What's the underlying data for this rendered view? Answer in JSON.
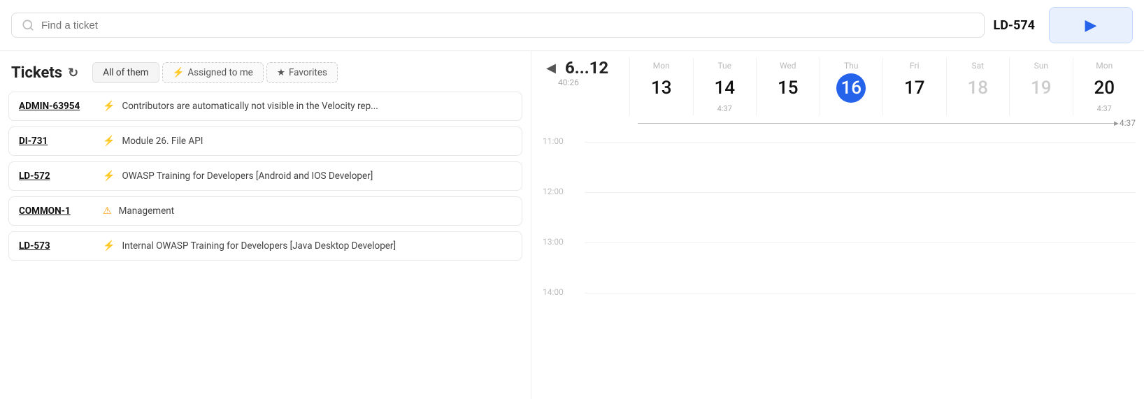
{
  "search": {
    "placeholder": "Find a ticket"
  },
  "ticket_badge": {
    "id": "LD-574"
  },
  "play_button": {
    "label": "Play"
  },
  "tickets_section": {
    "title": "Tickets",
    "filters": [
      {
        "id": "all",
        "label": "All of them",
        "active": true
      },
      {
        "id": "assigned",
        "label": "Assigned to me",
        "icon": "⚡",
        "active": false
      },
      {
        "id": "favorites",
        "label": "Favorites",
        "icon": "★",
        "active": false
      }
    ],
    "items": [
      {
        "id": "ADMIN-63954",
        "icon": "lightning",
        "icon_char": "⚡",
        "description": "Contributors are automatically not visible in the Velocity rep..."
      },
      {
        "id": "DI-731",
        "icon": "lightning",
        "icon_char": "⚡",
        "description": "Module 26. File API"
      },
      {
        "id": "LD-572",
        "icon": "lightning",
        "icon_char": "⚡",
        "description": "OWASP Training for Developers [Android and IOS Developer]"
      },
      {
        "id": "COMMON-1",
        "icon": "warning",
        "icon_char": "⚠",
        "description": "Management"
      },
      {
        "id": "LD-573",
        "icon": "lightning",
        "icon_char": "⚡",
        "description": "Internal OWASP Training for Developers [Java Desktop Developer]"
      }
    ]
  },
  "calendar": {
    "week_range": "6...12",
    "week_total": "40:26",
    "nav_prev": "◀",
    "nav_next": "▶",
    "time_end": "4:37",
    "days": [
      {
        "name": "Mon",
        "num": "13",
        "hours": "",
        "weekend": false,
        "today": false
      },
      {
        "name": "Tue",
        "num": "14",
        "hours": "4:37",
        "weekend": false,
        "today": false
      },
      {
        "name": "Wed",
        "num": "15",
        "hours": "",
        "weekend": false,
        "today": false
      },
      {
        "name": "Thu",
        "num": "16",
        "hours": "",
        "weekend": false,
        "today": true
      },
      {
        "name": "Fri",
        "num": "17",
        "hours": "",
        "weekend": false,
        "today": false
      },
      {
        "name": "Sat",
        "num": "18",
        "hours": "",
        "weekend": true,
        "today": false
      },
      {
        "name": "Sun",
        "num": "19",
        "hours": "",
        "weekend": true,
        "today": false
      },
      {
        "name": "Mon",
        "num": "20",
        "hours": "4:37",
        "weekend": false,
        "today": false
      }
    ],
    "time_slots": [
      {
        "time": "11:00",
        "offset": 0
      },
      {
        "time": "12:00",
        "offset": 72
      },
      {
        "time": "13:00",
        "offset": 144
      },
      {
        "time": "14:00",
        "offset": 216
      }
    ]
  }
}
